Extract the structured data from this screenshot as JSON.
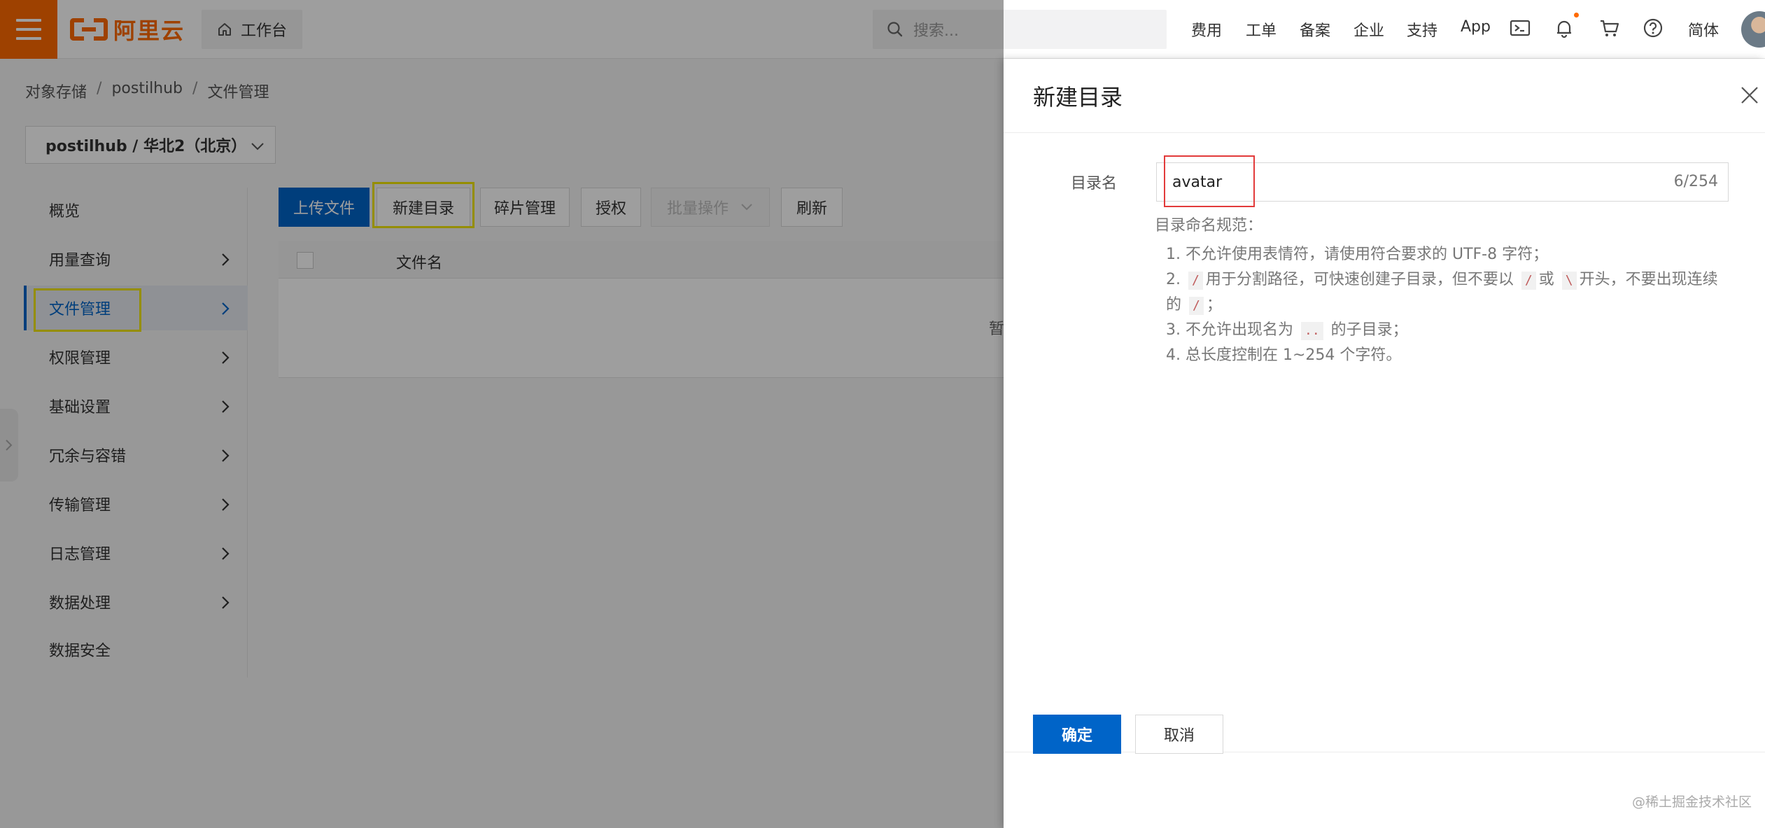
{
  "brand": {
    "name": "阿里云",
    "color": "#ff6a00"
  },
  "header": {
    "workbench_label": "工作台",
    "search_placeholder": "搜索...",
    "nav": [
      "费用",
      "工单",
      "备案",
      "企业",
      "支持",
      "App"
    ],
    "lang_label": "简体",
    "icons": [
      "terminal-icon",
      "bell-icon",
      "cart-icon",
      "help-icon"
    ]
  },
  "breadcrumb": [
    "对象存储",
    "postilhub",
    "文件管理"
  ],
  "bucket_selector": {
    "value": "postilhub / 华北2（北京）"
  },
  "sidebar": {
    "items": [
      {
        "label": "概览",
        "has_arrow": false
      },
      {
        "label": "用量查询",
        "has_arrow": true
      },
      {
        "label": "文件管理",
        "has_arrow": true,
        "active": true
      },
      {
        "label": "权限管理",
        "has_arrow": true
      },
      {
        "label": "基础设置",
        "has_arrow": true
      },
      {
        "label": "冗余与容错",
        "has_arrow": true
      },
      {
        "label": "传输管理",
        "has_arrow": true
      },
      {
        "label": "日志管理",
        "has_arrow": true
      },
      {
        "label": "数据处理",
        "has_arrow": true
      },
      {
        "label": "数据安全",
        "has_arrow": false
      }
    ]
  },
  "toolbar": {
    "upload": "上传文件",
    "new_dir": "新建目录",
    "fragments": "碎片管理",
    "authorize": "授权",
    "batch": "批量操作",
    "refresh": "刷新"
  },
  "table": {
    "column_name": "文件名",
    "empty_text": "暂"
  },
  "drawer": {
    "title": "新建目录",
    "field_label": "目录名",
    "field_value": "avatar",
    "char_count": "6/254",
    "rules_title": "目录命名规范：",
    "rules": {
      "r1": "1. 不允许使用表情符，请使用符合要求的 UTF-8 字符；",
      "r2_prefix": "2.",
      "r2_code1": "/",
      "r2_text1": "用于分割路径，可快速创建子目录，但不要以",
      "r2_code2": "/",
      "r2_or": "或",
      "r2_code3": "\\",
      "r2_text2": "开头，不要出现连续的",
      "r2_code4": "/",
      "r2_end": "；",
      "r3_prefix": "3. 不允许出现名为",
      "r3_code": "..",
      "r3_suffix": "的子目录；",
      "r4": "4. 总长度控制在 1~254 个字符。"
    },
    "ok": "确定",
    "cancel": "取消"
  },
  "watermark": "@稀土掘金技术社区",
  "colors": {
    "primary": "#0064c8",
    "highlight_yellow": "#f0e600",
    "highlight_red": "#e23a3a"
  }
}
